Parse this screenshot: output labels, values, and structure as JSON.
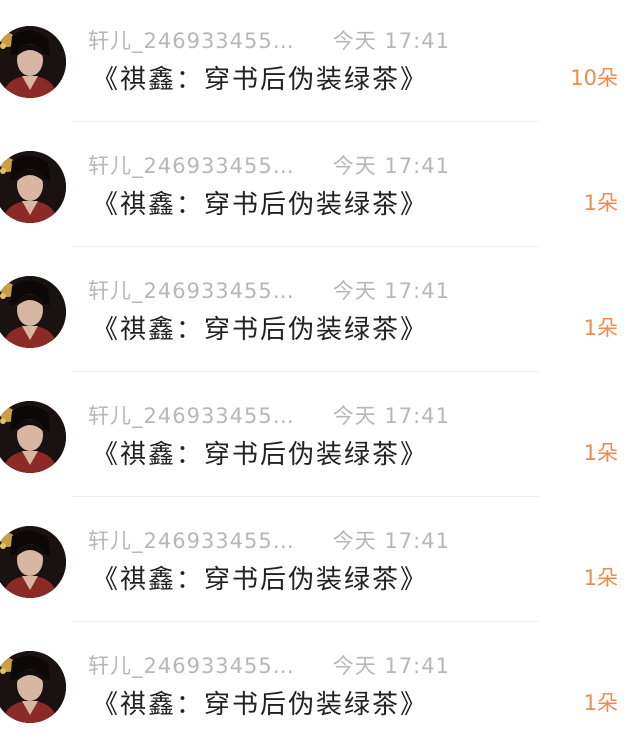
{
  "colors": {
    "meta_text": "#b7b7b7",
    "title_text": "#222222",
    "count_text": "#ef8a4f",
    "divider": "#f1f1f1",
    "background": "#ffffff"
  },
  "items": [
    {
      "avatar_icon": "user-avatar-icon",
      "username": "轩儿_246933455…",
      "time": "今天 17:41",
      "title": "《祺鑫：穿书后伪装绿茶》",
      "count": "10朵"
    },
    {
      "avatar_icon": "user-avatar-icon",
      "username": "轩儿_246933455…",
      "time": "今天 17:41",
      "title": "《祺鑫：穿书后伪装绿茶》",
      "count": "1朵"
    },
    {
      "avatar_icon": "user-avatar-icon",
      "username": "轩儿_246933455…",
      "time": "今天 17:41",
      "title": "《祺鑫：穿书后伪装绿茶》",
      "count": "1朵"
    },
    {
      "avatar_icon": "user-avatar-icon",
      "username": "轩儿_246933455…",
      "time": "今天 17:41",
      "title": "《祺鑫：穿书后伪装绿茶》",
      "count": "1朵"
    },
    {
      "avatar_icon": "user-avatar-icon",
      "username": "轩儿_246933455…",
      "time": "今天 17:41",
      "title": "《祺鑫：穿书后伪装绿茶》",
      "count": "1朵"
    },
    {
      "avatar_icon": "user-avatar-icon",
      "username": "轩儿_246933455…",
      "time": "今天 17:41",
      "title": "《祺鑫：穿书后伪装绿茶》",
      "count": "1朵"
    }
  ]
}
